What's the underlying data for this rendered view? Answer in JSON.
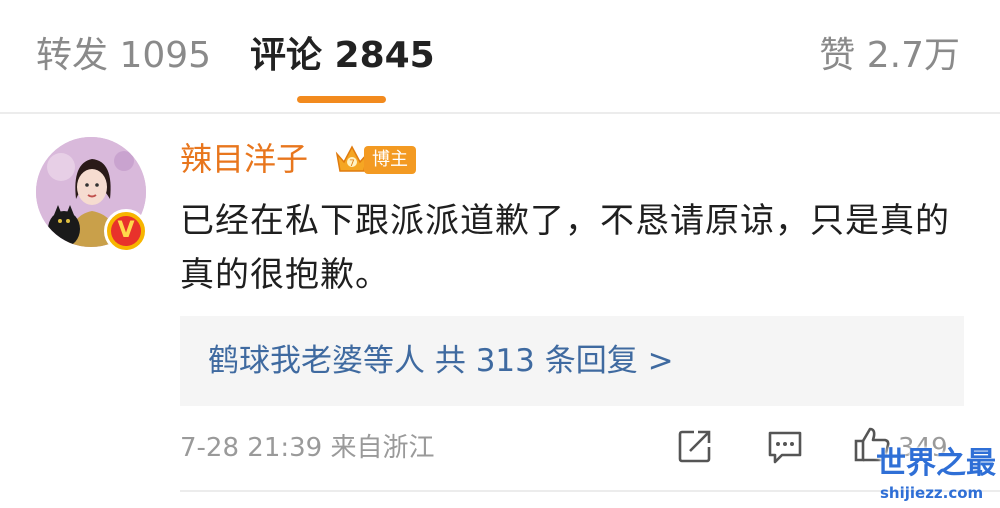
{
  "tabs": {
    "repost": "转发 1095",
    "comments": "评论 2845",
    "likes": "赞 2.7万"
  },
  "comment": {
    "username": "辣目洋子",
    "owner_badge": "博主",
    "verified_mark": "V",
    "text": "已经在私下跟派派道歉了，不恳请原谅，只是真的真的很抱歉。",
    "replies": "鹤球我老婆等人  共 313 条回复 >",
    "timestamp": "7-28 21:39  来自浙江",
    "like_count": "349"
  },
  "watermark": {
    "title": "世界之最",
    "url": "shijiezz.com"
  },
  "colors": {
    "accent": "#f28a1e",
    "username": "#e8761d",
    "link": "#3f6aa0"
  }
}
